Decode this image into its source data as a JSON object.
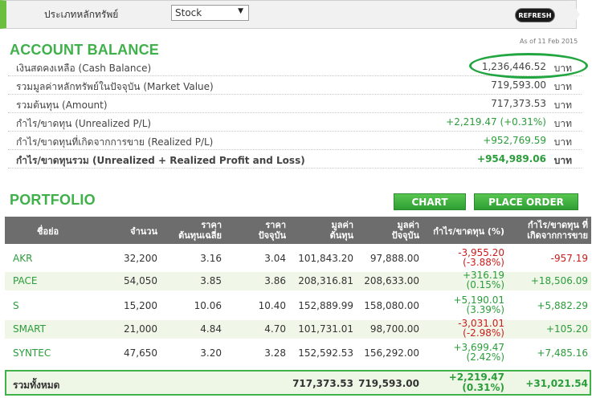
{
  "toolbar": {
    "category_label": "ประเภทหลักทรัพย์",
    "category_value": "Stock",
    "refresh_label": "REFRESH"
  },
  "account": {
    "title": "ACCOUNT BALANCE",
    "as_of": "As of 11 Feb 2015",
    "rows": [
      {
        "label": "เงินสดคงเหลือ (Cash Balance)",
        "value": "1,236,446.52",
        "unit": "บาท"
      },
      {
        "label": "รวมมูลค่าหลักทรัพย์ในปัจจุบัน (Market Value)",
        "value": "719,593.00",
        "unit": "บาท"
      },
      {
        "label": "รวมต้นทุน (Amount)",
        "value": "717,373.53",
        "unit": "บาท"
      },
      {
        "label": "กำไร/ขาดทุน (Unrealized P/L)",
        "value": "+2,219.47 (+0.31%)",
        "unit": "บาท"
      },
      {
        "label": "กำไร/ขาดทุนที่เกิดจากการขาย (Realized P/L)",
        "value": "+952,769.59",
        "unit": "บาท"
      },
      {
        "label": "กำไร/ขาดทุนรวม (Unrealized + Realized Profit and Loss)",
        "value": "+954,989.06",
        "unit": "บาท"
      }
    ]
  },
  "portfolio": {
    "title": "PORTFOLIO",
    "chart_label": "CHART",
    "place_order_label": "PLACE ORDER",
    "headers": {
      "symbol": "ชื่อย่อ",
      "volume": "จำนวน",
      "avg_cost": [
        "ราคา",
        "ต้นทุนเฉลี่ย"
      ],
      "market_price": [
        "ราคา",
        "ปัจจุบัน"
      ],
      "amount": [
        "มูลค่า",
        "ต้นทุน"
      ],
      "market_value": [
        "มูลค่า",
        "ปัจจุบัน"
      ],
      "unrealized": "กำไร/ขาดทุน (%)",
      "realized": [
        "กำไร/ขาดทุน ที่",
        "เกิดจากการขาย"
      ]
    },
    "rows": [
      {
        "symbol": "AKR",
        "volume": "32,200",
        "avg_cost": "3.16",
        "market_price": "3.04",
        "amount": "101,843.20",
        "market_value": "97,888.00",
        "pl": "-3,955.20",
        "pl_pct": "(-3.88%)",
        "realized": "-957.19"
      },
      {
        "symbol": "PACE",
        "volume": "54,050",
        "avg_cost": "3.85",
        "market_price": "3.86",
        "amount": "208,316.81",
        "market_value": "208,633.00",
        "pl": "+316.19",
        "pl_pct": "(0.15%)",
        "realized": "+18,506.09"
      },
      {
        "symbol": "S",
        "volume": "15,200",
        "avg_cost": "10.06",
        "market_price": "10.40",
        "amount": "152,889.99",
        "market_value": "158,080.00",
        "pl": "+5,190.01",
        "pl_pct": "(3.39%)",
        "realized": "+5,882.29"
      },
      {
        "symbol": "SMART",
        "volume": "21,000",
        "avg_cost": "4.84",
        "market_price": "4.70",
        "amount": "101,731.01",
        "market_value": "98,700.00",
        "pl": "-3,031.01",
        "pl_pct": "(-2.98%)",
        "realized": "+105.20"
      },
      {
        "symbol": "SYNTEC",
        "volume": "47,650",
        "avg_cost": "3.20",
        "market_price": "3.28",
        "amount": "152,592.53",
        "market_value": "156,292.00",
        "pl": "+3,699.47",
        "pl_pct": "(2.42%)",
        "realized": "+7,485.16"
      }
    ],
    "total": {
      "label": "รวมทั้งหมด",
      "amount": "717,373.53",
      "market_value": "719,593.00",
      "pl": "+2,219.47",
      "pl_pct": "(0.31%)",
      "realized": "+31,021.54"
    }
  },
  "colors": {
    "accent_green": "#3fb04a",
    "positive": "#2a9d3a",
    "negative": "#cc1b1b",
    "header_gray": "#6d6d6d"
  }
}
